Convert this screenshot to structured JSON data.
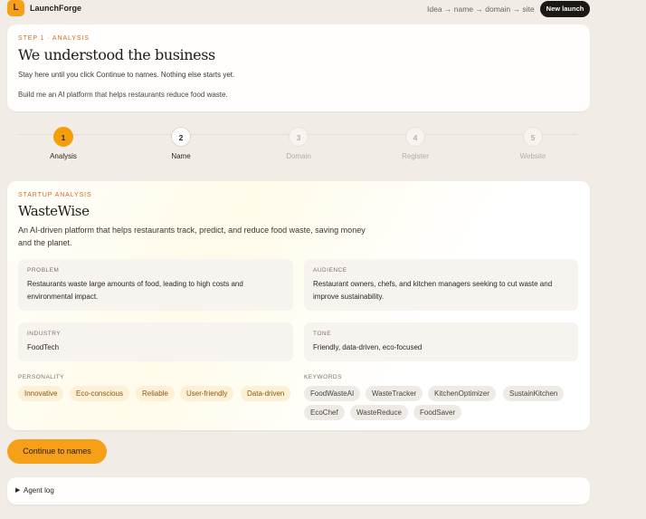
{
  "app": {
    "logo_letter": "L",
    "name": "LaunchForge",
    "flow": "Idea → name → domain → site",
    "new_launch": "New launch",
    "accent_color": "#f59e0b"
  },
  "step_card": {
    "eyebrow": "STEP 1 · ANALYSIS",
    "title": "We understood the business",
    "subtitle": "Stay here until you click Continue to names. Nothing else starts yet.",
    "prompt": "Build me an AI platform that helps restaurants reduce food waste."
  },
  "stepper": [
    {
      "number": "1",
      "label": "Analysis",
      "state": "active"
    },
    {
      "number": "2",
      "label": "Name",
      "state": "next"
    },
    {
      "number": "3",
      "label": "Domain",
      "state": "pending"
    },
    {
      "number": "4",
      "label": "Register",
      "state": "pending"
    },
    {
      "number": "5",
      "label": "Website",
      "state": "pending"
    }
  ],
  "analysis": {
    "eyebrow": "STARTUP ANALYSIS",
    "name": "WasteWise",
    "description": "An AI-driven platform that helps restaurants track, predict, and reduce food waste, saving money and the planet.",
    "problem": {
      "label": "PROBLEM",
      "value": "Restaurants waste large amounts of food, leading to high costs and environmental impact."
    },
    "audience": {
      "label": "AUDIENCE",
      "value": "Restaurant owners, chefs, and kitchen managers seeking to cut waste and improve sustainability."
    },
    "industry": {
      "label": "INDUSTRY",
      "value": "FoodTech"
    },
    "tone": {
      "label": "TONE",
      "value": "Friendly, data-driven, eco-focused"
    },
    "personality_label": "PERSONALITY",
    "personality": [
      "Innovative",
      "Eco-conscious",
      "Reliable",
      "User-friendly",
      "Data-driven"
    ],
    "keywords_label": "KEYWORDS",
    "keywords": [
      "FoodWasteAI",
      "WasteTracker",
      "KitchenOptimizer",
      "SustainKitchen",
      "EcoChef",
      "WasteReduce",
      "FoodSaver"
    ]
  },
  "continue_label": "Continue to names",
  "agent_log": {
    "caret": "▶",
    "label": "Agent log"
  }
}
